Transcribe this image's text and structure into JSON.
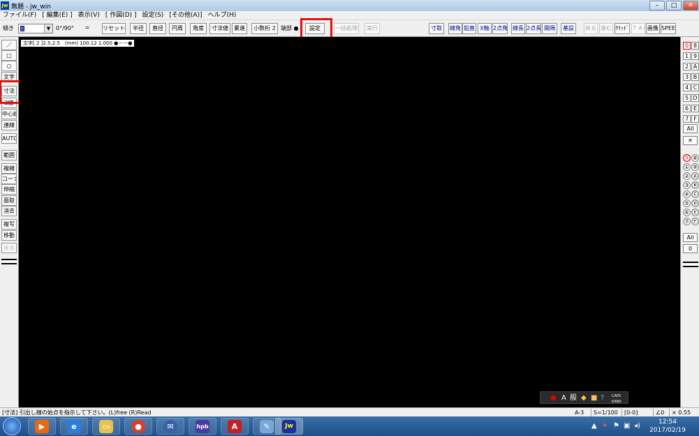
{
  "window": {
    "title": "無題 - jw_win",
    "app_icon": "Jw",
    "minimize": "–",
    "maximize": "□",
    "close": "✕"
  },
  "menu": [
    "ファイル(F)",
    "[ 編集(E) ]",
    "表示(V)",
    "[ 作図(D) ]",
    "設定(S)",
    "[その他(A)]",
    "ヘルプ(H)"
  ],
  "toolbar": {
    "line_label": "傾き",
    "angle": "0°/90°",
    "eq": "=",
    "reset": "リセット",
    "radius": "半径",
    "diameter": "直径",
    "circumference": "円周",
    "angle_btn": "角度",
    "dim_value": "寸法値",
    "cumulative": "累進",
    "decimals": "小数桁 2",
    "end_label": "端部 ●",
    "settings": "設定",
    "batch": "一括処理",
    "execute": "実行",
    "right": [
      "寸取",
      "線角",
      "鉛直",
      "X軸",
      "2点角",
      "線長",
      "2点長",
      "間隔",
      "基設"
    ],
    "far": [
      "戻る",
      "進む",
      "ｸﾘｯﾄﾞ",
      "ＴＡＧ",
      "画像",
      "SPEED"
    ]
  },
  "left_tools": [
    {
      "label": "／",
      "dis": false
    },
    {
      "label": "□",
      "dis": false
    },
    {
      "label": "○",
      "dis": false
    },
    {
      "label": "文字",
      "dis": false
    },
    {
      "label": "寸法",
      "dis": false
    },
    {
      "label": "2線",
      "dis": false
    },
    {
      "label": "中心線",
      "dis": false
    },
    {
      "label": "連線",
      "dis": false
    },
    {
      "label": "AUTO",
      "dis": false
    },
    {
      "label": "範囲",
      "dis": false
    },
    {
      "label": "複線",
      "dis": false
    },
    {
      "label": "コーナー",
      "dis": false
    },
    {
      "label": "伸縮",
      "dis": false
    },
    {
      "label": "面取",
      "dis": false
    },
    {
      "label": "消去",
      "dis": false
    },
    {
      "label": "複写",
      "dis": false
    },
    {
      "label": "移動",
      "dis": false
    },
    {
      "label": "戻る",
      "dis": true
    }
  ],
  "layer_groups": {
    "rows": [
      [
        "0",
        "8"
      ],
      [
        "1",
        "9"
      ],
      [
        "2",
        "A"
      ],
      [
        "3",
        "B"
      ],
      [
        "4",
        "C"
      ],
      [
        "5",
        "D"
      ],
      [
        "6",
        "E"
      ],
      [
        "7",
        "F"
      ]
    ],
    "all": "All",
    "cross": "✕"
  },
  "layers": {
    "rows": [
      [
        "⓪",
        "⑧"
      ],
      [
        "①",
        "⑨"
      ],
      [
        "②",
        "Ⓐ"
      ],
      [
        "③",
        "Ⓑ"
      ],
      [
        "④",
        "Ⓒ"
      ],
      [
        "⑤",
        "Ⓓ"
      ],
      [
        "⑥",
        "Ⓔ"
      ],
      [
        "⑦",
        "Ⓕ"
      ]
    ],
    "all": "All",
    "zero": "0"
  },
  "canvas": {
    "info": "文字[ 2 ]2.5,2.5　(mm)  100.12  1.000  ●－－●"
  },
  "ime": {
    "mode": "A",
    "dict": "般",
    "caps": "CAPS",
    "kana": "KANA"
  },
  "status": {
    "message": "[寸法] 引出し線の始点を指示して下さい。(L)free  (R)Read",
    "paper": "A-3",
    "scale": "S=1/100",
    "layer": "[0-0]",
    "angle": "∠0",
    "zoom": "× 0.55"
  },
  "taskbar": {
    "time": "12:54",
    "date": "2017/02/19",
    "apps": [
      "IE",
      "Explorer",
      "Chrome",
      "Thunderbird",
      "hpb",
      "AutoCAD",
      "Paint",
      "Jw"
    ]
  },
  "colors": {
    "accent_red": "#e01010",
    "canvas": "#000000",
    "taskbar": "#1d4f8a"
  }
}
